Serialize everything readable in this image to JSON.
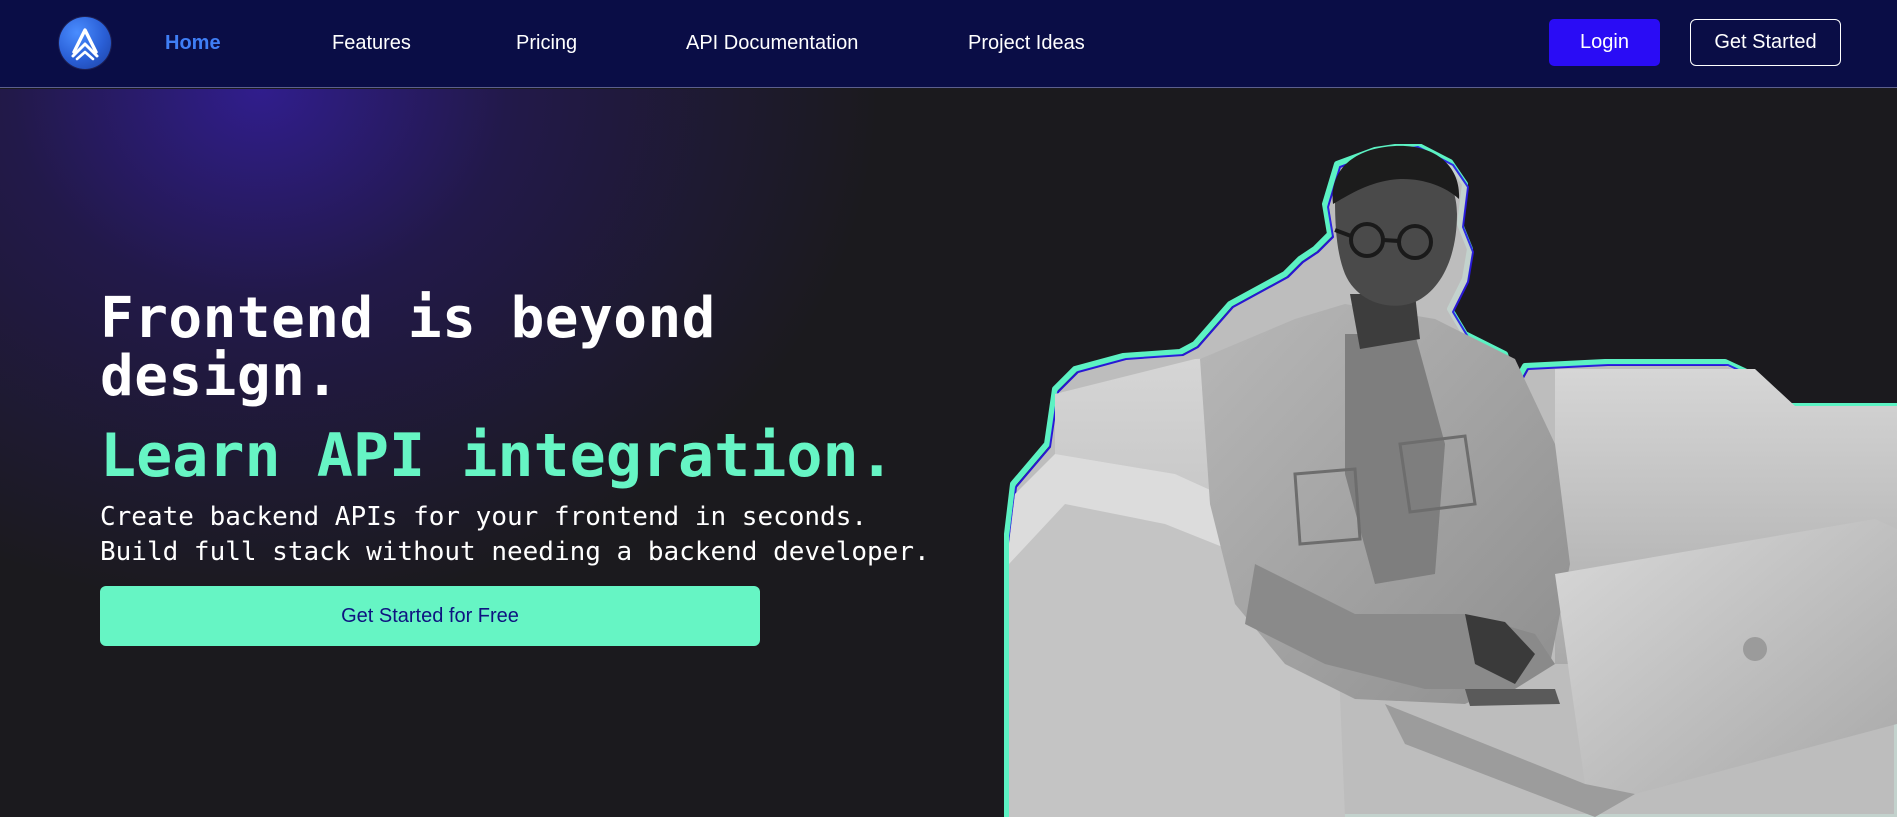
{
  "nav": {
    "logo_icon": "brand-logo-chevrons-icon",
    "links": [
      {
        "label": "Home",
        "active": true
      },
      {
        "label": "Features",
        "active": false
      },
      {
        "label": "Pricing",
        "active": false
      },
      {
        "label": "API Documentation",
        "active": false
      },
      {
        "label": "Project Ideas",
        "active": false
      }
    ],
    "login_label": "Login",
    "get_started_label": "Get Started"
  },
  "hero": {
    "headline": "Frontend is beyond design.",
    "subheadline": "Learn API integration.",
    "description": "Create backend APIs for your frontend in seconds. Build full stack without needing a backend developer.",
    "cta_label": "Get Started for Free"
  },
  "colors": {
    "nav_bg": "#0a0d46",
    "active_link": "#3f7ef5",
    "login_bg": "#2a0cf5",
    "accent_green": "#66f5c4",
    "cta_text": "#0e1380",
    "hero_bg": "#1b1a1e"
  }
}
